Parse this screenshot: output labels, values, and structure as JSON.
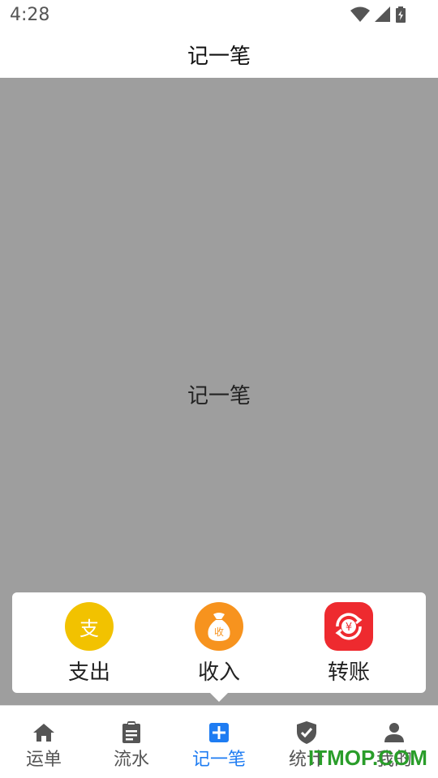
{
  "status_bar": {
    "time": "4:28"
  },
  "header": {
    "title": "记一笔"
  },
  "content": {
    "label": "记一笔"
  },
  "popup": {
    "items": [
      {
        "label": "支出",
        "icon": "expense-icon",
        "glyph": "支",
        "color": "#f2c200"
      },
      {
        "label": "收入",
        "icon": "income-bag-icon",
        "glyph": "收",
        "color": "#f7931e"
      },
      {
        "label": "转账",
        "icon": "transfer-icon",
        "glyph": "¥",
        "color": "#ee2a2f"
      }
    ]
  },
  "bottom_nav": {
    "items": [
      {
        "label": "运单",
        "icon": "home-icon",
        "active": false
      },
      {
        "label": "流水",
        "icon": "clipboard-icon",
        "active": false
      },
      {
        "label": "记一笔",
        "icon": "add-square-icon",
        "active": true
      },
      {
        "label": "统计",
        "icon": "shield-check-icon",
        "active": false
      },
      {
        "label": "我的",
        "icon": "person-icon",
        "active": false
      }
    ],
    "active_color": "#1e7cf2",
    "inactive_color": "#555555"
  },
  "watermark": {
    "text": "ITMOP.COM"
  }
}
